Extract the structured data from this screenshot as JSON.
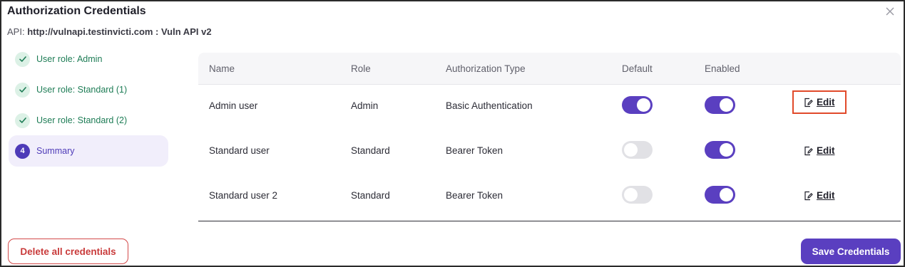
{
  "dialog": {
    "title": "Authorization Credentials",
    "api_prefix": "API:",
    "api_url": "http://vulnapi.testinvicti.com : Vuln API v2",
    "close_icon": "close-icon"
  },
  "steps": [
    {
      "label": "User role: Admin",
      "state": "done"
    },
    {
      "label": "User role: Standard (1)",
      "state": "done"
    },
    {
      "label": "User role: Standard (2)",
      "state": "done"
    },
    {
      "label": "Summary",
      "state": "active",
      "number": "4"
    }
  ],
  "table": {
    "headers": [
      "Name",
      "Role",
      "Authorization Type",
      "Default",
      "Enabled"
    ],
    "rows": [
      {
        "name": "Admin user",
        "role": "Admin",
        "auth_type": "Basic Authentication",
        "default": true,
        "enabled": true,
        "action": "Edit"
      },
      {
        "name": "Standard user",
        "role": "Standard",
        "auth_type": "Bearer Token",
        "default": false,
        "enabled": true,
        "action": "Edit"
      },
      {
        "name": "Standard user 2",
        "role": "Standard",
        "auth_type": "Bearer Token",
        "default": false,
        "enabled": true,
        "action": "Edit"
      }
    ]
  },
  "footer": {
    "delete_label": "Delete all credentials",
    "save_label": "Save Credentials"
  },
  "colors": {
    "accent": "#5a3fc0",
    "success": "#1d7c55",
    "danger": "#c93b3b",
    "highlight": "#e14a2a"
  }
}
